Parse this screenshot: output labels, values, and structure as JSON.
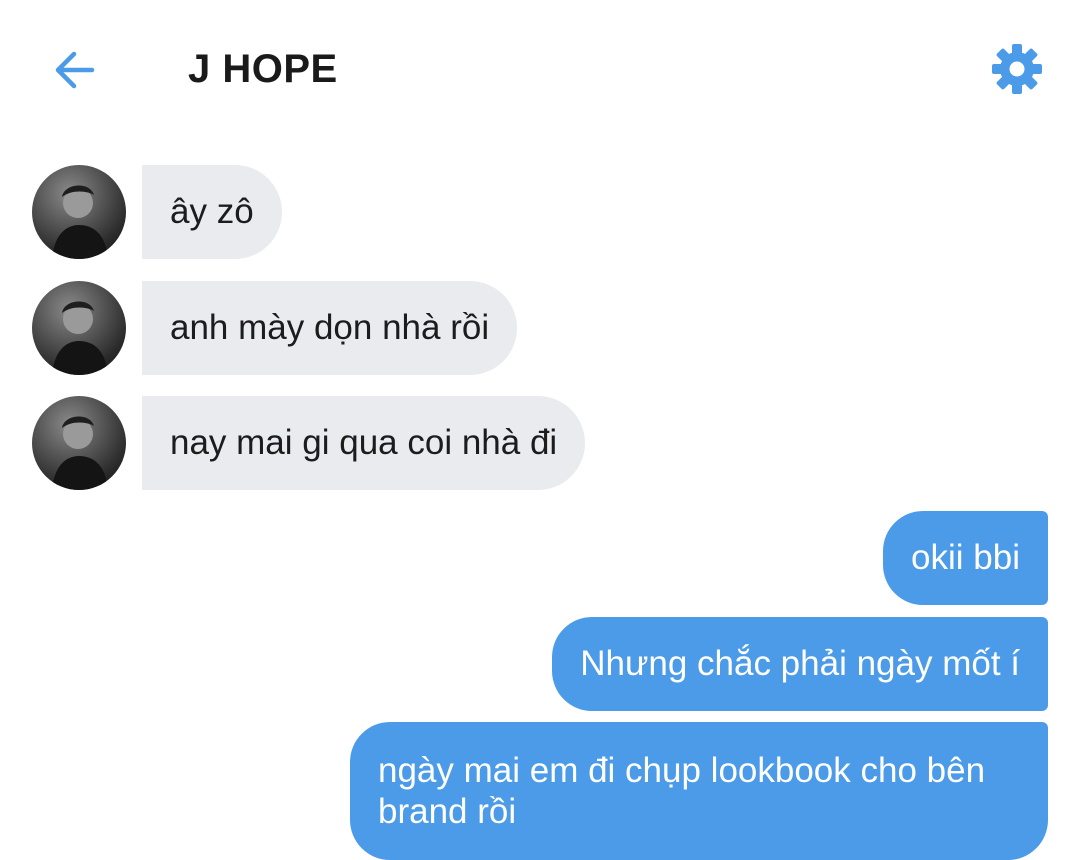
{
  "header": {
    "title": "J HOPE",
    "back_icon": "arrow-left-icon",
    "settings_icon": "gear-icon",
    "accent_color": "#4c9be8"
  },
  "messages": [
    {
      "direction": "incoming",
      "text": "ây zô"
    },
    {
      "direction": "incoming",
      "text": "anh mày dọn nhà rồi"
    },
    {
      "direction": "incoming",
      "text": "nay mai gi qua coi nhà đi"
    },
    {
      "direction": "outgoing",
      "text": "okii bbi"
    },
    {
      "direction": "outgoing",
      "text": "Nhưng chắc phải ngày mốt í"
    },
    {
      "direction": "outgoing",
      "text": "ngày mai em đi chụp lookbook cho bên brand rồi"
    }
  ],
  "colors": {
    "incoming_bubble": "#e9ebef",
    "outgoing_bubble": "#4c9be8"
  }
}
